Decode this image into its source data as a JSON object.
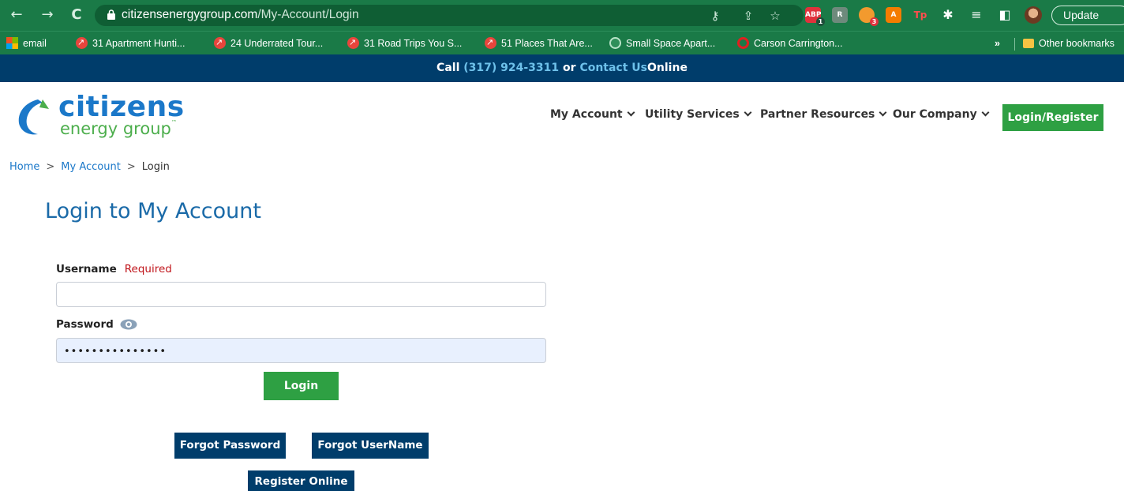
{
  "browser": {
    "url_domain": "citizensenergygroup.com",
    "url_path": "/My-Account/Login",
    "update_label": "Update",
    "extensions": [
      {
        "name": "adblock-plus",
        "label": "ABP",
        "badge": "1",
        "color": "#e0323c"
      },
      {
        "name": "extension-r",
        "label": "R",
        "badge": "",
        "color": "#6e8a7c"
      },
      {
        "name": "extension-rss",
        "label": "",
        "badge": "3",
        "color": "#f29a2e"
      },
      {
        "name": "extension-a",
        "label": "A",
        "badge": "",
        "color": "#f57c00"
      },
      {
        "name": "extension-tp",
        "label": "Tp",
        "badge": "",
        "color": "#e53935"
      }
    ]
  },
  "bookmarks": {
    "items": [
      {
        "label": "email",
        "icon": "microsoft-icon"
      },
      {
        "label": "31 Apartment Hunti...",
        "icon": "red-arrow-icon"
      },
      {
        "label": "24 Underrated Tour...",
        "icon": "red-arrow-icon"
      },
      {
        "label": "31 Road Trips You S...",
        "icon": "red-arrow-icon"
      },
      {
        "label": "51 Places That Are...",
        "icon": "red-arrow-icon"
      },
      {
        "label": "Small Space Apart...",
        "icon": "green-circle-icon"
      },
      {
        "label": "Carson Carrington...",
        "icon": "opera-icon"
      }
    ],
    "overflow": "»",
    "other_label": "Other bookmarks"
  },
  "callbar": {
    "call": "Call",
    "phone": "(317) 924-3311",
    "or": "or",
    "contact": "Contact Us",
    "online": "Online"
  },
  "logo": {
    "name": "citizens",
    "sub": "energy group",
    "tm": "™"
  },
  "nav": {
    "items": [
      {
        "label": "My Account"
      },
      {
        "label": "Utility Services"
      },
      {
        "label": "Partner Resources"
      },
      {
        "label": "Our Company"
      }
    ],
    "login_register": "Login/Register"
  },
  "breadcrumb": {
    "home": "Home",
    "sep": ">",
    "my_account": "My Account",
    "current": "Login"
  },
  "login": {
    "title": "Login to My Account",
    "username_label": "Username",
    "required_label": "Required",
    "username_value": "",
    "password_label": "Password",
    "password_mask": "•••••••••••••••",
    "login_button": "Login",
    "forgot_password": "Forgot Password",
    "forgot_username": "Forgot UserName",
    "register_online": "Register Online"
  },
  "colors": {
    "chrome": "#1a7a47",
    "navy": "#003d6b",
    "green": "#2ea043",
    "link": "#1b78c9"
  }
}
